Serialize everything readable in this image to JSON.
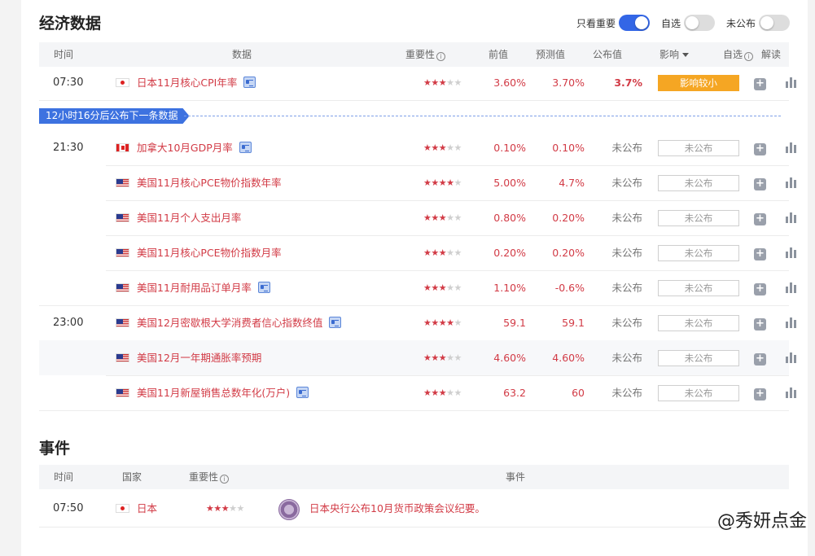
{
  "section_title": "经济数据",
  "toggles": [
    {
      "label": "只看重要",
      "on": true
    },
    {
      "label": "自选",
      "on": false
    },
    {
      "label": "未公布",
      "on": false
    }
  ],
  "columns": {
    "time": "时间",
    "data": "数据",
    "importance": "重要性",
    "previous": "前值",
    "forecast": "预测值",
    "actual": "公布值",
    "impact": "影响",
    "watch": "自选",
    "interpret": "解读"
  },
  "banner": "12小时16分后公布下一条数据",
  "rows": [
    {
      "time": "07:30",
      "flag": "jp",
      "name": "日本11月核心CPI年率",
      "doc": true,
      "stars": 3,
      "prev": "3.60%",
      "forecast": "3.70%",
      "actual": "3.7%",
      "impact": "影响较小"
    },
    {
      "time": "21:30",
      "flag": "ca",
      "name": "加拿大10月GDP月率",
      "doc": true,
      "stars": 3,
      "prev": "0.10%",
      "forecast": "0.10%",
      "actual": "未公布",
      "impact": "未公布"
    },
    {
      "time": "",
      "flag": "us",
      "name": "美国11月核心PCE物价指数年率",
      "doc": false,
      "stars": 4,
      "prev": "5.00%",
      "forecast": "4.7%",
      "actual": "未公布",
      "impact": "未公布"
    },
    {
      "time": "",
      "flag": "us",
      "name": "美国11月个人支出月率",
      "doc": false,
      "stars": 3,
      "prev": "0.80%",
      "forecast": "0.20%",
      "actual": "未公布",
      "impact": "未公布"
    },
    {
      "time": "",
      "flag": "us",
      "name": "美国11月核心PCE物价指数月率",
      "doc": false,
      "stars": 3,
      "prev": "0.20%",
      "forecast": "0.20%",
      "actual": "未公布",
      "impact": "未公布"
    },
    {
      "time": "",
      "flag": "us",
      "name": "美国11月耐用品订单月率",
      "doc": true,
      "stars": 3,
      "prev": "1.10%",
      "forecast": "-0.6%",
      "actual": "未公布",
      "impact": "未公布"
    },
    {
      "time": "23:00",
      "flag": "us",
      "name": "美国12月密歇根大学消费者信心指数终值",
      "doc": true,
      "stars": 4,
      "prev": "59.1",
      "forecast": "59.1",
      "actual": "未公布",
      "impact": "未公布"
    },
    {
      "time": "",
      "flag": "us",
      "name": "美国12月一年期通胀率预期",
      "doc": false,
      "stars": 3,
      "prev": "4.60%",
      "forecast": "4.60%",
      "actual": "未公布",
      "impact": "未公布"
    },
    {
      "time": "",
      "flag": "us",
      "name": "美国11月新屋销售总数年化(万户)",
      "doc": true,
      "stars": 3,
      "prev": "63.2",
      "forecast": "60",
      "actual": "未公布",
      "impact": "未公布"
    }
  ],
  "events_title": "事件",
  "event_columns": {
    "time": "时间",
    "country": "国家",
    "importance": "重要性",
    "event": "事件"
  },
  "events": [
    {
      "time": "07:50",
      "flag": "jp",
      "country": "日本",
      "stars": 3,
      "text": "日本央行公布10月货币政策会议纪要。"
    }
  ],
  "watermark": "@秀妍点金",
  "colors": {
    "accent_red": "#d23b46",
    "toggle_blue": "#3366e6",
    "impact_orange": "#f5a623",
    "banner_blue": "#3d72e0"
  }
}
